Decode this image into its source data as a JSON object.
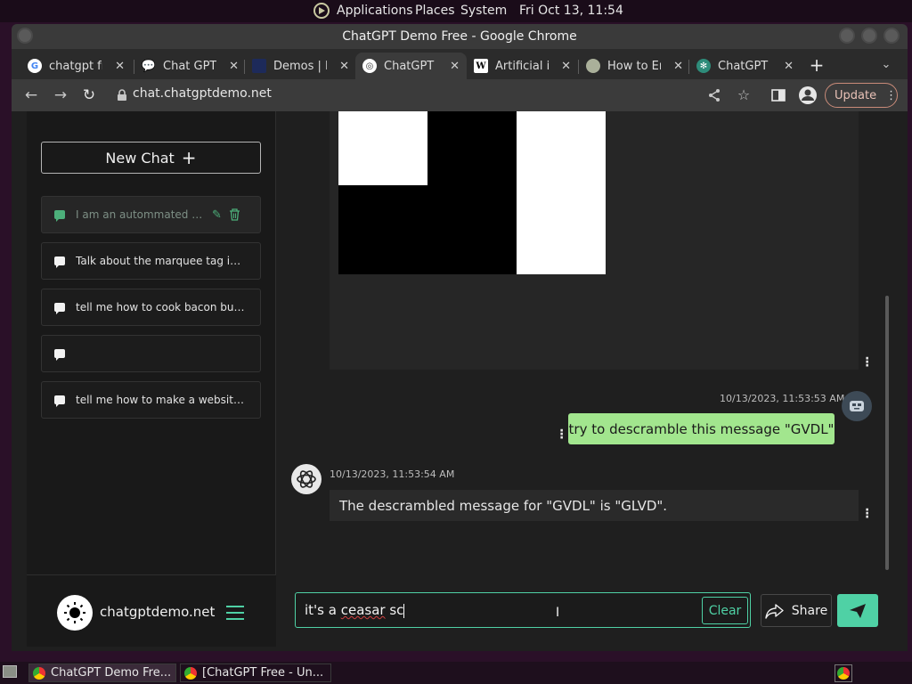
{
  "top_panel": {
    "applications": "Applications",
    "places": "Places",
    "system": "System",
    "clock": "Fri Oct 13, 11:54"
  },
  "window": {
    "title": "ChatGPT Demo Free - Google Chrome"
  },
  "tabs": [
    {
      "label": "chatgpt fre",
      "icon": "google-icon",
      "active": false
    },
    {
      "label": "Chat GPT C",
      "icon": "chat-bubble-icon",
      "active": false
    },
    {
      "label": "Demos | In",
      "icon": "demos-icon",
      "active": false
    },
    {
      "label": "ChatGPT D",
      "icon": "chatgpt-icon",
      "active": true
    },
    {
      "label": "Artificial in",
      "icon": "wikipedia-icon",
      "active": false
    },
    {
      "label": "How to En",
      "icon": "howto-icon",
      "active": false
    },
    {
      "label": "ChatGPT F",
      "icon": "openai-icon",
      "active": false
    }
  ],
  "toolbar": {
    "url": "chat.chatgptdemo.net",
    "update_label": "Update"
  },
  "sidebar": {
    "new_chat_label": "New Chat",
    "history": [
      {
        "label": "I am an autommated scri...",
        "active": true
      },
      {
        "label": "Talk about the marquee tag in gre...",
        "active": false
      },
      {
        "label": "tell me how to cook bacon but wri...",
        "active": false
      },
      {
        "label": "",
        "active": false
      },
      {
        "label": "tell me how to make a website but...",
        "active": false
      }
    ],
    "site_name": "chatgptdemo.net"
  },
  "messages": [
    {
      "role": "user",
      "timestamp": "10/13/2023, 11:53:53 AM",
      "text": "try to descramble this message \"GVDL\""
    },
    {
      "role": "assistant",
      "timestamp": "10/13/2023, 11:53:54 AM",
      "text": "The descrambled message for \"GVDL\" is \"GLVD\"."
    }
  ],
  "composer": {
    "value_prefix": "it's a ",
    "value_misspelled": "ceasar",
    "value_suffix": " sc",
    "clear_label": "Clear",
    "share_label": "Share"
  },
  "taskbar": {
    "items": [
      "ChatGPT Demo Fre...",
      "[ChatGPT Free - Un..."
    ]
  },
  "colors": {
    "accent": "#4fd1a5",
    "user_bubble": "#a2e68e",
    "update_border": "#c98b79"
  }
}
